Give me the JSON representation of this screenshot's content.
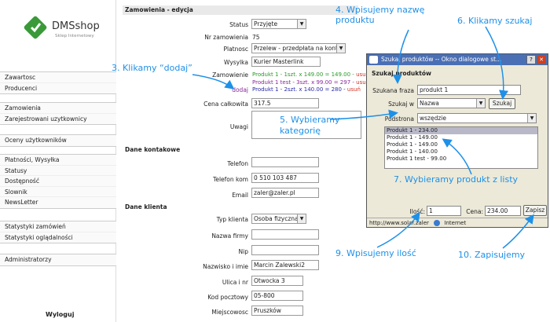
{
  "logo": {
    "name": "DMSshop",
    "subtitle": "Sklep Internetowy"
  },
  "sidebar": {
    "groups": [
      [
        "Zawartosc",
        "Producenci"
      ],
      [
        "Zamowienia",
        "Zarejestrowani uzytkownicy"
      ],
      [
        "Oceny użytkowników"
      ],
      [
        "Płatności, Wysyłka",
        "Statusy",
        "Dostępność",
        "Slownik",
        "NewsLetter"
      ],
      [
        "Statystyki zamówień",
        "Statystyki oglądalności"
      ],
      [
        "Administratorzy"
      ]
    ],
    "logout": "Wyloguj"
  },
  "form": {
    "section_title": "Zamowienia - edycja",
    "status_label": "Status",
    "status_value": "Przyjęte",
    "nr_label": "Nr zamowienia",
    "nr_value": "75",
    "platnosc_label": "Platnosc",
    "platnosc_value": "Przelew - przedpłata na konto",
    "wysylka_label": "Wysylka",
    "wysylka_value": "Kurier Masterlink",
    "zamowienie_label": "Zamowienie",
    "dodaj_label": "dodaj",
    "products": [
      {
        "text": "Produkt 1 - 1szt. x 149.00 = 149.00 - ",
        "remove": "usuń",
        "color": "#2a9a2a"
      },
      {
        "text": "Produkt 1 test - 3szt. x 99.00 = 297 - ",
        "remove": "usuń",
        "color": "#8a2a9a"
      },
      {
        "text": "Produkt 1 - 2szt. x 140.00 = 280 - ",
        "remove": "usuń",
        "color": "#2a2aaa"
      }
    ],
    "cena_label": "Cena całkowita",
    "cena_value": "317.5",
    "uwagi_label": "Uwagi",
    "kontakt_title": "Dane kontakowe",
    "telefon_label": "Telefon",
    "telefon_value": "",
    "telkom_label": "Telefon kom",
    "telkom_value": "0 510 103 487",
    "email_label": "Email",
    "email_value": "zaler@zaler.pl",
    "klient_title": "Dane klienta",
    "typ_label": "Typ klienta",
    "typ_value": "Osoba fizyczna",
    "firma_label": "Nazwa firmy",
    "firma_value": "",
    "nip_label": "Nip",
    "nip_value": "",
    "nazwisko_label": "Nazwisko i imie",
    "nazwisko_value": "Marcin Zalewski2",
    "ulica_label": "Ulica i nr",
    "ulica_value": "Otwocka 3",
    "kod_label": "Kod pocztowy",
    "kod_value": "05-800",
    "miasto_label": "Miejscowosc",
    "miasto_value": "Pruszków"
  },
  "dialog": {
    "title": "Szukaj produktów -- Okno dialogowe st...",
    "heading": "Szukaj produktów",
    "fraza_label": "Szukana fraza",
    "fraza_value": "produkt 1",
    "szukajw_label": "Szukaj w",
    "szukajw_value": "Nazwa",
    "search_button": "Szukaj",
    "podstrona_label": "Podstrona",
    "podstrona_value": "wszędzie",
    "results": [
      "Produkt 1 - 234.00",
      "Produkt 1 - 149.00",
      "Produkt 1 - 149.00",
      "Produkt 1 - 140.00",
      "Produkt 1 test - 99.00"
    ],
    "ilosc_label": "Ilość:",
    "ilosc_value": "1",
    "cena_label": "Cena:",
    "cena_value": "234.00",
    "save_button": "Zapisz",
    "status_url": "http://www.solar.zaler",
    "status_zone": "Internet"
  },
  "annotations": {
    "a3": "3. Klikamy “dodaj”",
    "a4": "4. Wpisujemy nazwę produktu",
    "a5": "5. Wybieramy kategorię",
    "a6": "6. Klikamy szukaj",
    "a7": "7. Wybieramy produkt z listy",
    "a9": "9. Wpisujemy ilość",
    "a10": "10. Zapisujemy"
  },
  "colors": {
    "annotation": "#1e90e8",
    "titlebar": "#4a6fb5",
    "remove_link": "#d03020",
    "logo_green": "#3a9a3a"
  }
}
